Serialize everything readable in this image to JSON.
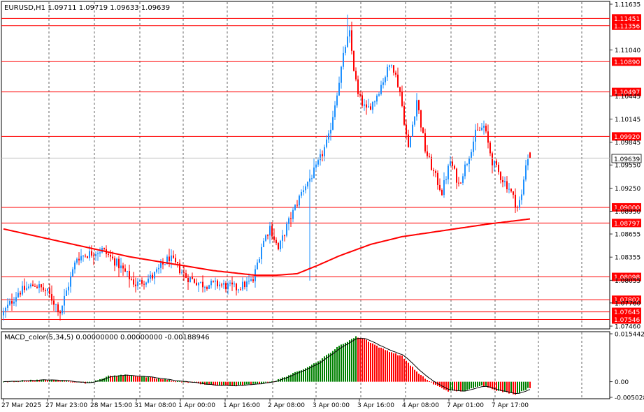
{
  "header": {
    "symbol_line": "EURUSD,H1  1.09711 1.09719 1.09633 1.09639",
    "indicator_line": "MACD_color(5,34,5) 0.00000000 0.00000000 -0.00188946"
  },
  "price_axis": {
    "ticks": [
      "1.11635",
      "1.11040",
      "1.10445",
      "1.10145",
      "1.09845",
      "1.09550",
      "1.09250",
      "1.08950",
      "1.08655",
      "1.08355",
      "1.08055",
      "1.07760",
      "1.07460"
    ],
    "current_price_label": "1.09639"
  },
  "levels": [
    {
      "label": "1.11451",
      "value": 1.11451
    },
    {
      "label": "1.11356",
      "value": 1.11356
    },
    {
      "label": "1.10890",
      "value": 1.1089
    },
    {
      "label": "1.10497",
      "value": 1.10497
    },
    {
      "label": "1.09920",
      "value": 1.0992
    },
    {
      "label": "1.09000",
      "value": 1.09
    },
    {
      "label": "1.08797",
      "value": 1.08797
    },
    {
      "label": "1.08098",
      "value": 1.08098
    },
    {
      "label": "1.07802",
      "value": 1.07802
    },
    {
      "label": "1.07645",
      "value": 1.07645
    },
    {
      "label": "1.07546",
      "value": 1.07546
    }
  ],
  "macd_axis": {
    "ticks": [
      "0.0154428",
      "0.00",
      "-0.005028"
    ]
  },
  "time_axis": {
    "labels": [
      "27 Mar 2025",
      "27 Mar 23:00",
      "28 Mar 15:00",
      "31 Mar 08:00",
      "1 Apr 00:00",
      "1 Apr 16:00",
      "2 Apr 08:00",
      "3 Apr 00:00",
      "3 Apr 16:00",
      "4 Apr 08:00",
      "7 Apr 01:00",
      "7 Apr 17:00"
    ]
  },
  "colors": {
    "bull": "#1e90ff",
    "bear": "#ff0000",
    "level": "#ff0000",
    "ma": "#ff0000",
    "macd_up": "#008000",
    "macd_down": "#ff0000",
    "signal": "#000000",
    "grid": "#000000"
  },
  "chart_data": {
    "type": "candlestick",
    "symbol": "EURUSD",
    "timeframe": "H1",
    "last_bar": {
      "open": 1.09711,
      "high": 1.09719,
      "low": 1.09633,
      "close": 1.09639
    },
    "ylim": [
      1.0746,
      1.11635
    ],
    "macd_ylim": [
      -0.005028,
      0.0154428
    ],
    "waypoints": [
      [
        0,
        1.076
      ],
      [
        8,
        1.079
      ],
      [
        16,
        1.08
      ],
      [
        22,
        1.079
      ],
      [
        28,
        1.0765
      ],
      [
        36,
        1.0835
      ],
      [
        48,
        1.0845
      ],
      [
        56,
        1.0825
      ],
      [
        64,
        1.08
      ],
      [
        72,
        1.081
      ],
      [
        80,
        1.0835
      ],
      [
        88,
        1.081
      ],
      [
        96,
        1.08
      ],
      [
        104,
        1.08
      ],
      [
        112,
        1.0795
      ],
      [
        120,
        1.0805
      ],
      [
        124,
        1.085
      ],
      [
        128,
        1.0875
      ],
      [
        132,
        1.0845
      ],
      [
        136,
        1.0875
      ],
      [
        140,
        1.09
      ],
      [
        144,
        1.0925
      ],
      [
        150,
        1.095
      ],
      [
        156,
        1.099
      ],
      [
        160,
        1.105
      ],
      [
        164,
        1.111
      ],
      [
        166,
        1.1125
      ],
      [
        168,
        1.108
      ],
      [
        170,
        1.1045
      ],
      [
        174,
        1.1025
      ],
      [
        178,
        1.104
      ],
      [
        182,
        1.1065
      ],
      [
        186,
        1.109
      ],
      [
        190,
        1.105
      ],
      [
        194,
        1.0975
      ],
      [
        198,
        1.104
      ],
      [
        202,
        1.0975
      ],
      [
        206,
        1.0945
      ],
      [
        210,
        1.092
      ],
      [
        214,
        1.096
      ],
      [
        218,
        1.093
      ],
      [
        222,
        1.096
      ],
      [
        226,
        1.0995
      ],
      [
        230,
        1.1005
      ],
      [
        234,
        1.096
      ],
      [
        238,
        1.094
      ],
      [
        242,
        1.0925
      ],
      [
        246,
        1.09
      ],
      [
        248,
        1.0915
      ],
      [
        250,
        1.0958
      ],
      [
        251,
        1.09639
      ]
    ],
    "ma_points": [
      [
        0,
        1.0872
      ],
      [
        20,
        1.086
      ],
      [
        40,
        1.0848
      ],
      [
        60,
        1.0836
      ],
      [
        80,
        1.0827
      ],
      [
        100,
        1.0818
      ],
      [
        120,
        1.0812
      ],
      [
        130,
        1.0812
      ],
      [
        140,
        1.0814
      ],
      [
        150,
        1.0825
      ],
      [
        160,
        1.0837
      ],
      [
        175,
        1.0852
      ],
      [
        190,
        1.0862
      ],
      [
        210,
        1.087
      ],
      [
        230,
        1.0878
      ],
      [
        251,
        1.0885
      ]
    ],
    "macd_waypoints": [
      [
        0,
        0.0
      ],
      [
        10,
        0.0004
      ],
      [
        20,
        0.0006
      ],
      [
        30,
        0.0003
      ],
      [
        40,
        -0.0005
      ],
      [
        50,
        0.0018
      ],
      [
        58,
        0.0022
      ],
      [
        68,
        0.0015
      ],
      [
        80,
        0.0004
      ],
      [
        90,
        -0.0003
      ],
      [
        100,
        -0.0012
      ],
      [
        110,
        -0.0013
      ],
      [
        120,
        -0.0008
      ],
      [
        130,
        0.0004
      ],
      [
        140,
        0.0032
      ],
      [
        150,
        0.0065
      ],
      [
        160,
        0.0115
      ],
      [
        168,
        0.0145
      ],
      [
        172,
        0.0138
      ],
      [
        180,
        0.0108
      ],
      [
        190,
        0.0082
      ],
      [
        198,
        0.0025
      ],
      [
        205,
        -0.0008
      ],
      [
        212,
        -0.003
      ],
      [
        220,
        -0.003
      ],
      [
        228,
        -0.001
      ],
      [
        236,
        -0.003
      ],
      [
        244,
        -0.004
      ],
      [
        251,
        -0.0019
      ]
    ]
  }
}
